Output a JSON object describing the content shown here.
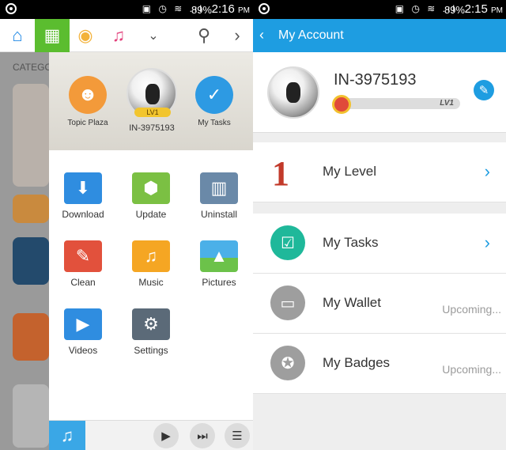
{
  "left_screen": {
    "status": {
      "battery": "89%",
      "time": "2:16",
      "ampm": "PM"
    },
    "background_category": "CATEGO",
    "profile": {
      "topic_label": "Topic Plaza",
      "level_badge": "LV1",
      "username": "IN-3975193",
      "tasks_label": "My Tasks"
    },
    "grid": [
      {
        "label": "Download",
        "icon": "download-icon",
        "color": "#2f8de0"
      },
      {
        "label": "Update",
        "icon": "update-icon",
        "color": "#7bc043"
      },
      {
        "label": "Uninstall",
        "icon": "trash-icon",
        "color": "#6a89a8"
      },
      {
        "label": "Clean",
        "icon": "broom-icon",
        "color": "#e2513c"
      },
      {
        "label": "Music",
        "icon": "music-icon",
        "color": "#f5a623"
      },
      {
        "label": "Pictures",
        "icon": "picture-icon",
        "color": "#4bb0e8"
      },
      {
        "label": "Videos",
        "icon": "video-icon",
        "color": "#2f8de0"
      },
      {
        "label": "Settings",
        "icon": "gear-icon",
        "color": "#5b6a78"
      }
    ]
  },
  "right_screen": {
    "status": {
      "battery": "89%",
      "time": "2:15",
      "ampm": "PM"
    },
    "header_title": "My Account",
    "username": "IN-3975193",
    "level": "LV1",
    "level_progress": 0.05,
    "level_number": "1",
    "rows": {
      "level": {
        "label": "My Level"
      },
      "tasks": {
        "label": "My Tasks"
      },
      "wallet": {
        "label": "My Wallet",
        "status": "Upcoming..."
      },
      "badges": {
        "label": "My Badges",
        "status": "Upcoming..."
      }
    },
    "colors": {
      "accent": "#1e9de1",
      "tasks_green": "#1fb89a",
      "disabled_gray": "#9e9e9e"
    }
  }
}
